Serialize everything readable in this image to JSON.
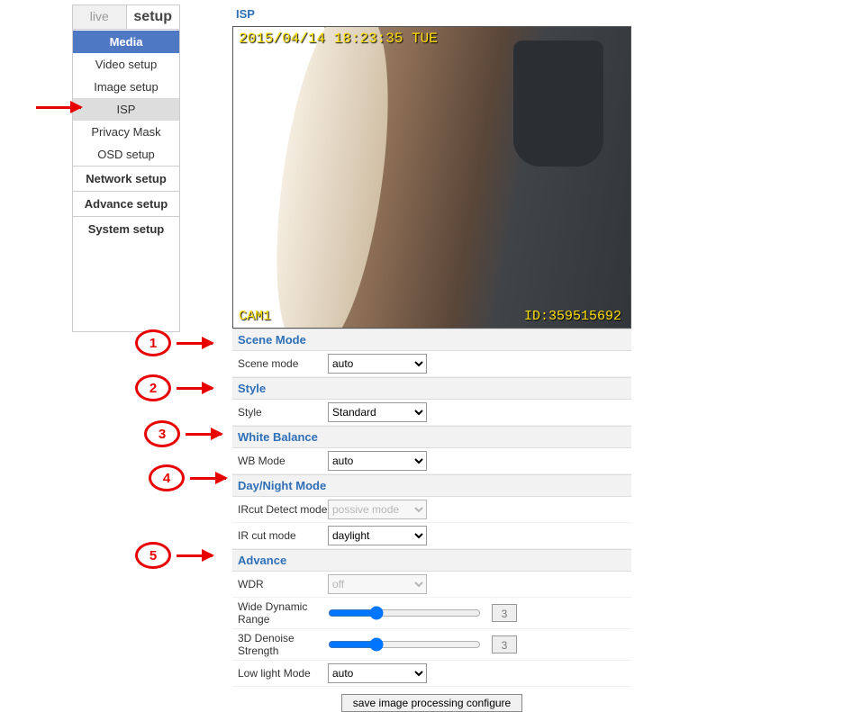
{
  "tabs": {
    "live": "live",
    "setup": "setup"
  },
  "sidebar": {
    "media_header": "Media",
    "items": [
      {
        "label": "Video setup"
      },
      {
        "label": "Image setup"
      },
      {
        "label": "ISP"
      },
      {
        "label": "Privacy Mask"
      },
      {
        "label": "OSD setup"
      }
    ],
    "groups": [
      {
        "label": "Network setup"
      },
      {
        "label": "Advance setup"
      },
      {
        "label": "System setup"
      }
    ]
  },
  "page": {
    "title": "ISP"
  },
  "preview": {
    "timestamp": "2015/04/14 18:23:35 TUE",
    "cam": "CAM1",
    "id": "ID:359515692"
  },
  "groups": {
    "scene": {
      "header": "Scene Mode",
      "label": "Scene mode",
      "value": "auto"
    },
    "style": {
      "header": "Style",
      "label": "Style",
      "value": "Standard"
    },
    "wb": {
      "header": "White Balance",
      "label": "WB Mode",
      "value": "auto"
    },
    "dn": {
      "header": "Day/Night Mode",
      "ircut_detect_label": "IRcut Detect mode",
      "ircut_detect_value": "possive mode",
      "ircut_mode_label": "IR cut mode",
      "ircut_mode_value": "daylight"
    },
    "adv": {
      "header": "Advance",
      "wdr_label": "WDR",
      "wdr_value": "off",
      "wdr_range_label": "Wide Dynamic Range",
      "wdr_range_value": "3",
      "denoise_label": "3D Denoise Strength",
      "denoise_value": "3",
      "lowlight_label": "Low light Mode",
      "lowlight_value": "auto"
    }
  },
  "save_button": "save image processing configure",
  "annotations": {
    "n1": "1",
    "n2": "2",
    "n3": "3",
    "n4": "4",
    "n5": "5"
  }
}
